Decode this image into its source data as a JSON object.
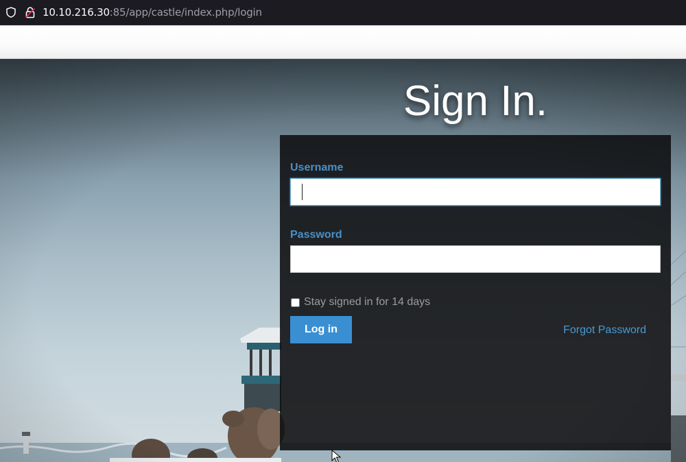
{
  "browser": {
    "url_host": "10.10.216.30",
    "url_rest": ":85/app/castle/index.php/login",
    "icons": [
      "shield-icon",
      "lock-warning-icon"
    ]
  },
  "login": {
    "title": "Sign In.",
    "username_label": "Username",
    "username_value": "",
    "password_label": "Password",
    "password_value": "",
    "remember_label": "Stay signed in for 14 days",
    "remember_checked": false,
    "submit_label": "Log in",
    "forgot_label": "Forgot Password"
  },
  "colors": {
    "accent": "#3a8fd3",
    "label": "#4a90c8",
    "panel": "#0e0e10"
  }
}
